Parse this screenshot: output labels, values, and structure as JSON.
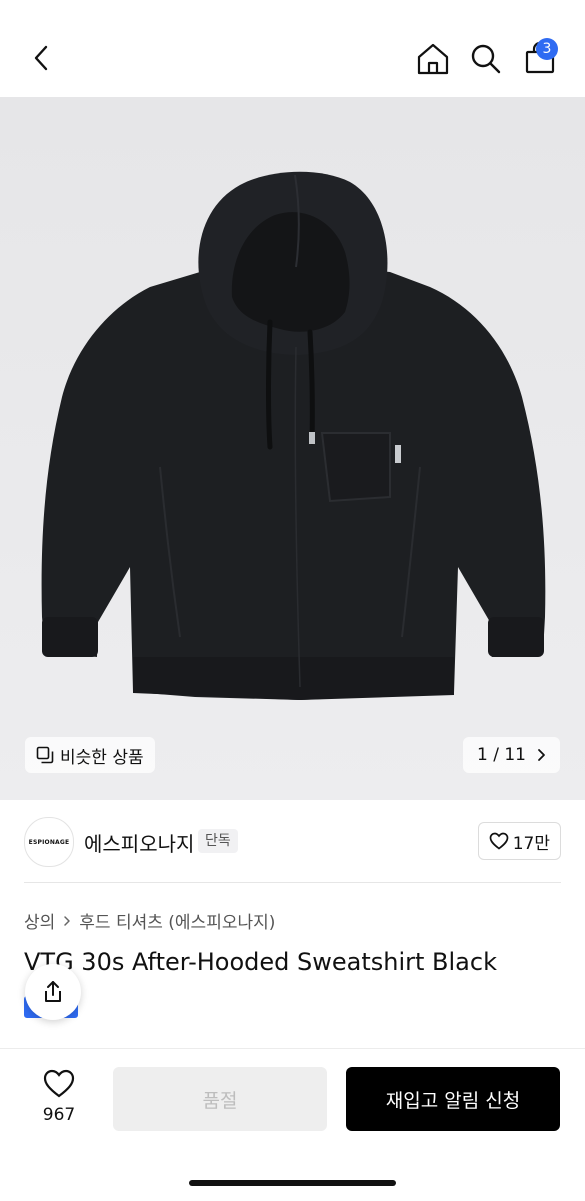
{
  "header": {
    "back_icon": "chevron-left-icon",
    "home_icon": "home-icon",
    "search_icon": "search-icon",
    "cart_icon": "shopping-bag-icon",
    "cart_count": "3",
    "accent_color": "#2f6bf2"
  },
  "gallery": {
    "similar_label": "비슷한 상품",
    "pager": "1 / 11",
    "pager_icon": "chevron-right-icon"
  },
  "brand": {
    "logo_text": "ESPIONAGE",
    "name": "에스피오나지",
    "tag": "단독",
    "likes": "17만"
  },
  "product": {
    "breadcrumb": [
      "상의",
      "후드 티셔츠 (에스피오나지)"
    ],
    "title": "VTG 30s After-Hooded Sweatshirt Black"
  },
  "bottom": {
    "wish_count": "967",
    "soldout_label": "품절",
    "restock_label": "재입고 알림 신청"
  }
}
